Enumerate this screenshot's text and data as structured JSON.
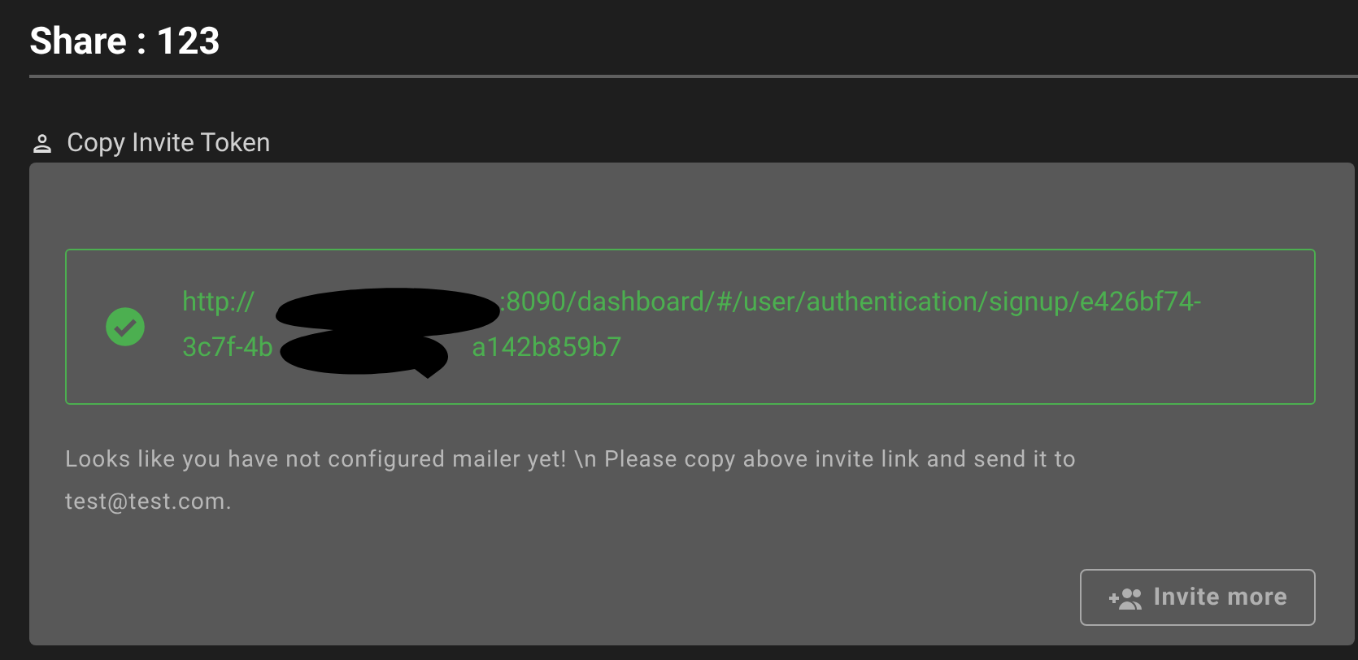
{
  "title": "Share : 123",
  "section": {
    "label": "Copy Invite Token"
  },
  "invite": {
    "url_lines": [
      [
        "http://",
        ":8090/dashboard/#/user/authentication/signup/e426bf74-"
      ],
      [
        "3c7f-4b",
        "a142b859b7"
      ]
    ]
  },
  "message": "Looks like you have not configured mailer yet! \\n Please copy above invite link and send it to test@test.com.",
  "buttons": [
    {
      "label": "Invite more",
      "disabled": true
    }
  ]
}
